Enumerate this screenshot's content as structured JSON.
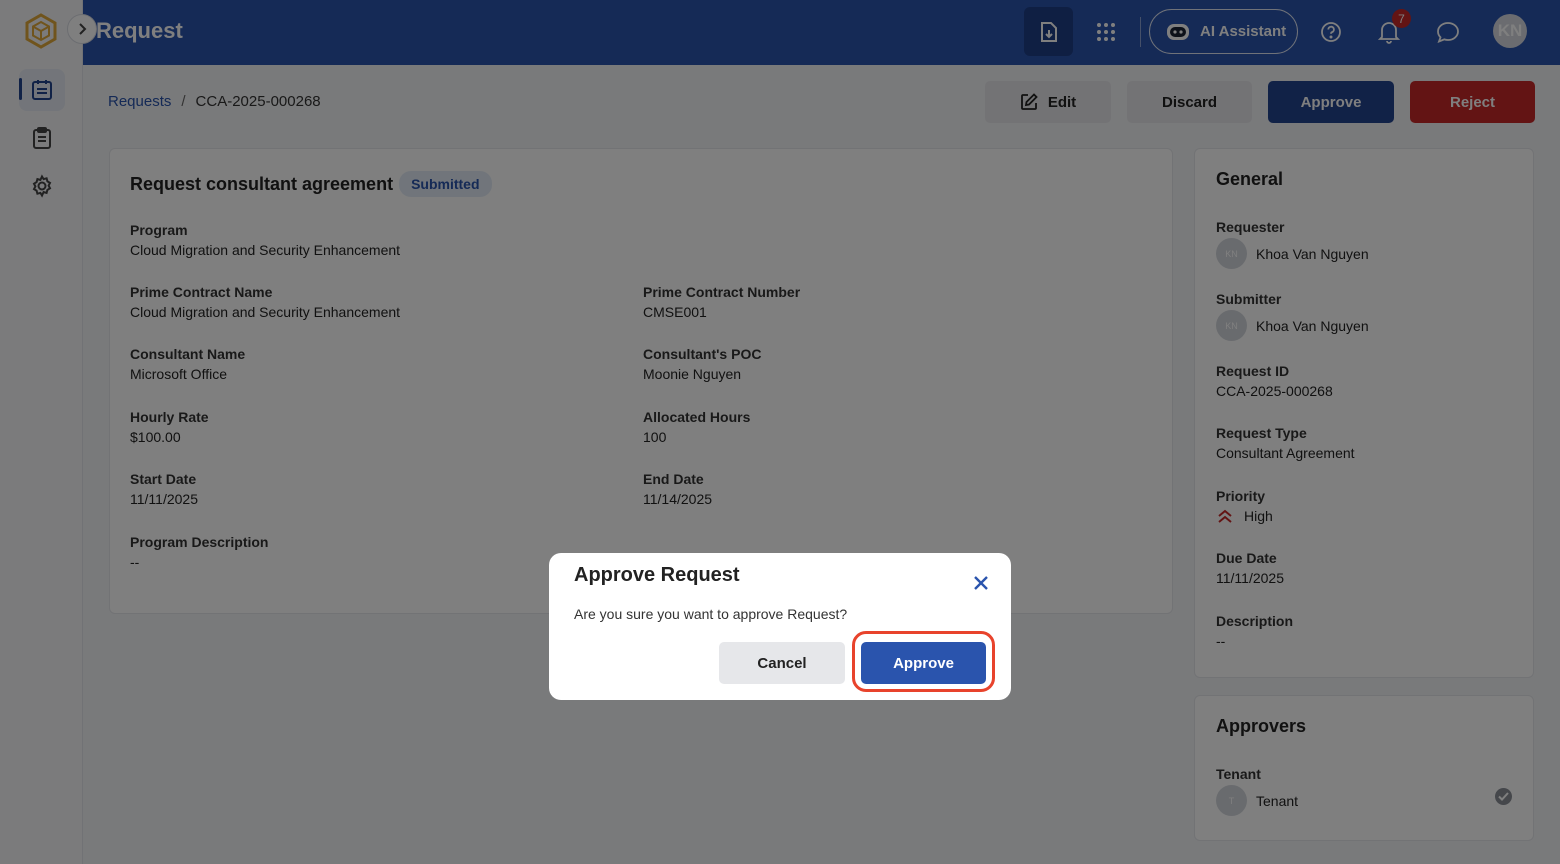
{
  "header": {
    "title": "Request",
    "ai_label": "AI Assistant",
    "notification_count": "7",
    "avatar_initials": "KN"
  },
  "breadcrumb": {
    "root": "Requests",
    "separator": "/",
    "current": "CCA-2025-000268"
  },
  "actions": {
    "edit": "Edit",
    "discard": "Discard",
    "approve": "Approve",
    "reject": "Reject"
  },
  "request": {
    "title": "Request consultant agreement",
    "status": "Submitted",
    "fields": {
      "program": {
        "label": "Program",
        "value": "Cloud Migration and Security Enhancement"
      },
      "prime_contract_name": {
        "label": "Prime Contract Name",
        "value": "Cloud Migration and Security Enhancement"
      },
      "prime_contract_number": {
        "label": "Prime Contract Number",
        "value": "CMSE001"
      },
      "consultant_name": {
        "label": "Consultant Name",
        "value": "Microsoft Office"
      },
      "consultant_poc": {
        "label": "Consultant's POC",
        "value": "Moonie Nguyen"
      },
      "hourly_rate": {
        "label": "Hourly Rate",
        "value": "$100.00"
      },
      "allocated_hours": {
        "label": "Allocated Hours",
        "value": "100"
      },
      "start_date": {
        "label": "Start Date",
        "value": "11/11/2025"
      },
      "end_date": {
        "label": "End Date",
        "value": "11/14/2025"
      },
      "program_description": {
        "label": "Program Description",
        "value": "--"
      }
    }
  },
  "general": {
    "title": "General",
    "requester": {
      "label": "Requester",
      "initials": "KN",
      "name": "Khoa Van Nguyen"
    },
    "submitter": {
      "label": "Submitter",
      "initials": "KN",
      "name": "Khoa Van Nguyen"
    },
    "request_id": {
      "label": "Request ID",
      "value": "CCA-2025-000268"
    },
    "request_type": {
      "label": "Request Type",
      "value": "Consultant Agreement"
    },
    "priority": {
      "label": "Priority",
      "value": "High"
    },
    "due_date": {
      "label": "Due Date",
      "value": "11/11/2025"
    },
    "description": {
      "label": "Description",
      "value": "--"
    }
  },
  "approvers": {
    "title": "Approvers",
    "items": [
      {
        "group": "Tenant",
        "initials": "T",
        "name": "Tenant"
      }
    ]
  },
  "dialog": {
    "title": "Approve Request",
    "message": "Are you sure you want to approve Request?",
    "cancel": "Cancel",
    "confirm": "Approve"
  },
  "colors": {
    "brand": "#2a54ad",
    "brand_dark": "#23458f",
    "reject": "#c62828",
    "highlight_ring": "#e8432c"
  },
  "icons": {
    "logo": "hexagon-logo-icon",
    "export": "file-download-icon",
    "apps": "grid-dots-icon",
    "ai": "robot-icon",
    "help": "help-circle-icon",
    "notifications": "bell-icon",
    "chat": "chat-bubble-icon",
    "priority_high": "double-chevron-up-icon"
  }
}
